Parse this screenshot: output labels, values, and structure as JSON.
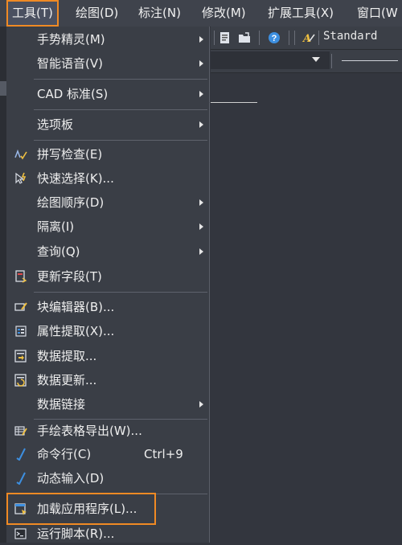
{
  "menubar": {
    "items": [
      {
        "label": "工具(T)"
      },
      {
        "label": "绘图(D)"
      },
      {
        "label": "标注(N)"
      },
      {
        "label": "修改(M)"
      },
      {
        "label": "扩展工具(X)"
      },
      {
        "label": "窗口(W"
      }
    ]
  },
  "toolbar": {
    "text_style": "Standard"
  },
  "tools_menu": {
    "items": [
      {
        "label": "手势精灵(M)"
      },
      {
        "label": "智能语音(V)"
      },
      {
        "label": "CAD 标准(S)"
      },
      {
        "label": "选项板"
      },
      {
        "label": "拼写检查(E)"
      },
      {
        "label": "快速选择(K)..."
      },
      {
        "label": "绘图顺序(D)"
      },
      {
        "label": "隔离(I)"
      },
      {
        "label": "查询(Q)"
      },
      {
        "label": "更新字段(T)"
      },
      {
        "label": "块编辑器(B)..."
      },
      {
        "label": "属性提取(X)..."
      },
      {
        "label": "数据提取..."
      },
      {
        "label": "数据更新..."
      },
      {
        "label": "数据链接"
      },
      {
        "label": "手绘表格导出(W)..."
      },
      {
        "label": "命令行(C)",
        "shortcut": "Ctrl+9"
      },
      {
        "label": "动态输入(D)"
      },
      {
        "label": "加载应用程序(L)..."
      },
      {
        "label": "运行脚本(R)..."
      }
    ]
  },
  "colors": {
    "highlight": "#f08a24",
    "menu_bg": "#3a3e46",
    "check": "#3d8fe0"
  }
}
